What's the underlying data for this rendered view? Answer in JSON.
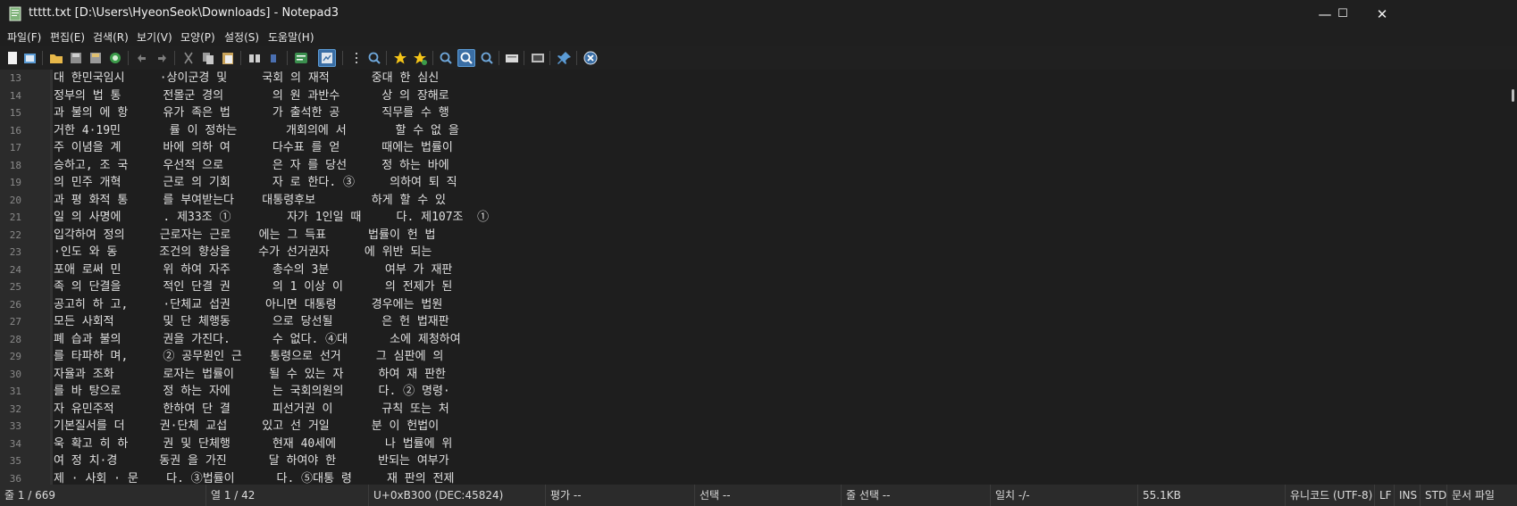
{
  "window": {
    "title": "ttttt.txt [D:\\Users\\HyeonSeok\\Downloads] - Notepad3",
    "minimize": "—",
    "maximize": "☐",
    "close": "✕"
  },
  "menu": [
    "파일(F)",
    "편집(E)",
    "검색(R)",
    "보기(V)",
    "모양(P)",
    "설정(S)",
    "도움말(H)"
  ],
  "toolbar_icons": [
    "new-file-icon",
    "new-window-icon",
    "open-folder-icon",
    "save-icon",
    "save-as-icon",
    "browse-icon",
    "undo-icon",
    "redo-icon",
    "cut-icon",
    "copy-icon",
    "paste-icon",
    "find-icon",
    "replace-icon",
    "word-wrap-icon",
    "zoom-view-icon",
    "wrap-toggle-icon",
    "find-next-icon",
    "favorites-icon",
    "add-favorite-icon",
    "zoom-in-icon",
    "zoom-reset-icon",
    "zoom-out-icon",
    "scheme-icon",
    "customize-icon",
    "pin-icon",
    "close-doc-icon"
  ],
  "editor": {
    "lines": [
      {
        "n": "13",
        "t": "대 한민국임시     ·상이군경 및     국회 의 재적      중대 한 심신"
      },
      {
        "n": "14",
        "t": "정부의 법 통      전몰군 경의       의 원 과반수      상 의 장해로"
      },
      {
        "n": "15",
        "t": "과 불의 에 항     유가 족은 법      가 출석한 공      직무를 수 행"
      },
      {
        "n": "16",
        "t": "거한 4·19민       률 이 정하는       개회의에 서       할 수 없 을"
      },
      {
        "n": "17",
        "t": "주 이념을 계      바에 의하 여      다수표 를 얻      때에는 법률이"
      },
      {
        "n": "18",
        "t": "승하고, 조 국     우선적 으로       은 자 를 당선     정 하는 바에"
      },
      {
        "n": "19",
        "t": "의 민주 개혁      근로 의 기회      자 로 한다. ③     의하여 퇴 직"
      },
      {
        "n": "20",
        "t": "과 평 화적 통     를 부여받는다    대통령후보        하게 할 수 있"
      },
      {
        "n": "21",
        "t": "일 의 사명에      . 제33조 ①        자가 1인일 때     다. 제107조  ①"
      },
      {
        "n": "22",
        "t": "입각하여 정의     근로자는 근로    에는 그 득표      법률이 헌 법"
      },
      {
        "n": "23",
        "t": "·인도 와 동      조건의 향상을    수가 선거권자     에 위반 되는"
      },
      {
        "n": "24",
        "t": "포애 로써 민      위 하여 자주      총수의 3분        여부 가 재판"
      },
      {
        "n": "25",
        "t": "족 의 단결을      적인 단결 권      의 1 이상 이      의 전제가 된"
      },
      {
        "n": "26",
        "t": "공고히 하 고,     ·단체교 섭권     아니면 대통령     경우에는 법원"
      },
      {
        "n": "27",
        "t": "모든 사회적       및 단 체행동      으로 당선될       은 헌 법재판"
      },
      {
        "n": "28",
        "t": "폐 습과 불의      권을 가진다.      수 없다. ④대      소에 제청하여"
      },
      {
        "n": "29",
        "t": "를 타파하 며,     ② 공무원인 근    통령으로 선거     그 심판에 의"
      },
      {
        "n": "30",
        "t": "자율과 조화       로자는 법률이     될 수 있는 자     하여 재 판한"
      },
      {
        "n": "31",
        "t": "를 바 탕으로      정 하는 자에      는 국회의원의     다. ② 명령·"
      },
      {
        "n": "32",
        "t": "자 유민주적       한하여 단 결      피선거권 이       규칙 또는 처"
      },
      {
        "n": "33",
        "t": "기본질서를 더     권·단체 교섭     있고 선 거일      분 이 헌법이"
      },
      {
        "n": "34",
        "t": "욱 확고 히 하     권 및 단체행      현재 40세에       나 법률에 위"
      },
      {
        "n": "35",
        "t": "여 정 치·경      동권 을 가진      달 하여야 한      반되는 여부가"
      },
      {
        "n": "36",
        "t": "제 · 사회 · 문    다. ③법률이      다. ⑤대통 령     재 판의 전제"
      }
    ]
  },
  "status": {
    "line": "줄 1 / 669",
    "column": "열 1 / 42",
    "char": "U+0xB300 (DEC:45824)",
    "eval": "평가 --",
    "selection": "선택 --",
    "line_selection": "줄 선택 --",
    "match": "일치 -/-",
    "size": "55.1KB",
    "encoding": "유니코드 (UTF-8)",
    "eol": "LF",
    "ins": "INS",
    "mode": "STD",
    "doctype": "문서 파일"
  }
}
